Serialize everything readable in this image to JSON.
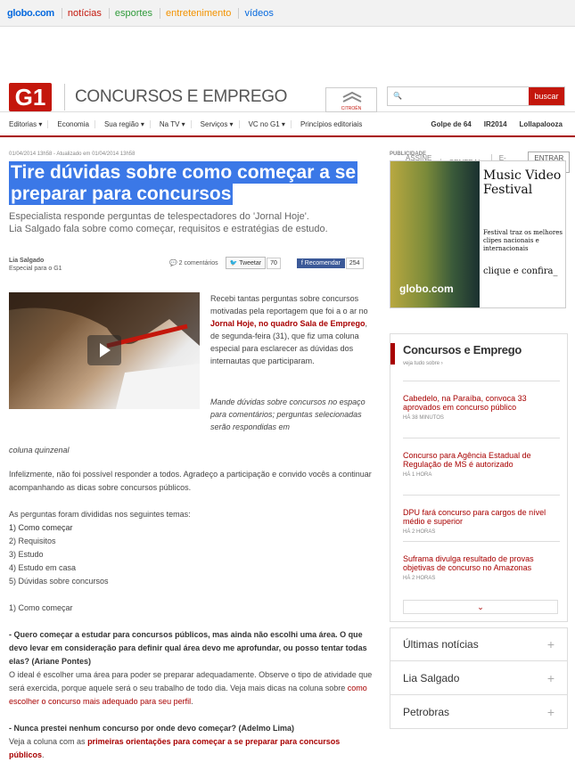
{
  "topbar": {
    "brand": "globo.com",
    "nav": [
      {
        "label": "notícias",
        "color": "#c4170c"
      },
      {
        "label": "esportes",
        "color": "#2f9a3a"
      },
      {
        "label": "entretenimento",
        "color": "#f39200"
      },
      {
        "label": "vídeos",
        "color": "#0669de"
      }
    ],
    "right": [
      "ASSINE JÁ",
      "CENTRAL",
      "E-MAIL▾"
    ],
    "entrar": "ENTRAR ›"
  },
  "header": {
    "logo": "G1",
    "section": "CONCURSOS E EMPREGO",
    "ad_small": "CITROËN",
    "search_button": "buscar",
    "search_placeholder": ""
  },
  "subnav": {
    "items": [
      "Editorias ▾",
      "Economia",
      "Sua região ▾",
      "Na TV ▾",
      "Serviços ▾",
      "VC no G1 ▾",
      "Princípios editoriais"
    ],
    "trending": [
      "Golpe de 64",
      "IR2014",
      "Lollapalooza"
    ]
  },
  "article": {
    "meta": "01/04/2014 13h58 - Atualizado em 01/04/2014 13h58",
    "title": "Tire dúvidas sobre como começar a se preparar para concursos",
    "subtitle1": "Especialista responde perguntas de telespectadores do 'Jornal Hoje'.",
    "subtitle2": "Lia Salgado fala sobre como começar, requisitos e estratégias de estudo.",
    "author": "Lia Salgado",
    "author_role": "Especial para o G1",
    "comments": "2 comentários",
    "tweet": "Tweetar",
    "tweet_count": "70",
    "like": "Recomendar",
    "like_count": "254",
    "p1_a": "Recebi tantas perguntas sobre concursos motivadas pela reportagem que foi a o ar no ",
    "p1_link": "Jornal Hoje, no quadro Sala de Emprego",
    "p1_b": ", de segunda-feira (31), que fiz uma coluna especial para esclarecer as dúvidas dos internautas que participaram.",
    "p2": "Mande dúvidas sobre concursos no espaço para comentários; perguntas selecionadas serão respondidas em",
    "p2_end": "coluna quinzenal",
    "p3": "Infelizmente, não foi possível responder a todos. Agradeço a participação e convido vocês a continuar acompanhando as dicas sobre concursos públicos.",
    "p4": "As perguntas foram divididas nos seguintes temas:",
    "topics": [
      "1) Como começar",
      "2) Requisitos",
      "3) Estudo",
      "4) Estudo em casa",
      "5) Dúvidas sobre concursos"
    ],
    "section1": "1) Como começar",
    "q1": "- Quero começar a estudar para concursos públicos, mas ainda não escolhi uma área. O que devo levar em consideração para definir qual área devo me aprofundar, ou posso tentar todas elas?",
    "q1_author": "(Ariane Pontes)",
    "a1": "O ideal é escolher uma área para poder se preparar adequadamente. Observe o tipo de atividade que será exercida, porque aquele será o seu trabalho de todo dia. Veja mais dicas na coluna sobre ",
    "a1_link": "como escolher o concurso mais adequado para seu perfil",
    "q2": "- Nunca prestei nenhum concurso por onde devo começar? (Adelmo Lima)",
    "a2": "Veja a coluna com as ",
    "a2_link": "primeiras orientações para começar a se preparar para concursos públicos"
  },
  "sidebar": {
    "pub": "PUBLICIDADE",
    "ad_title": "Music Video Festival",
    "ad_text": "Festival traz os melhores clipes nacionais e internacionais",
    "ad_cta": "clique e confira_",
    "ad_logo": "globo.com",
    "box_title": "Concursos e Emprego",
    "box_see": "veja tudo sobre ›",
    "news": [
      {
        "title": "Cabedelo, na Paraíba, convoca 33 aprovados em concurso público",
        "time": "HÁ 38 MINUTOS"
      },
      {
        "title": "Concurso para Agência Estadual de Regulação de MS é autorizado",
        "time": "HÁ 1 HORA"
      },
      {
        "title": "DPU fará concurso para cargos de nível médio e superior",
        "time": "HÁ 2 HORAS"
      },
      {
        "title": "Suframa divulga resultado de provas objetivas de concurso no Amazonas",
        "time": "HÁ 2 HORAS"
      }
    ],
    "more": "⌄",
    "accordions": [
      "Últimas notícias",
      "Lia Salgado",
      "Petrobras"
    ],
    "plus": "+"
  }
}
